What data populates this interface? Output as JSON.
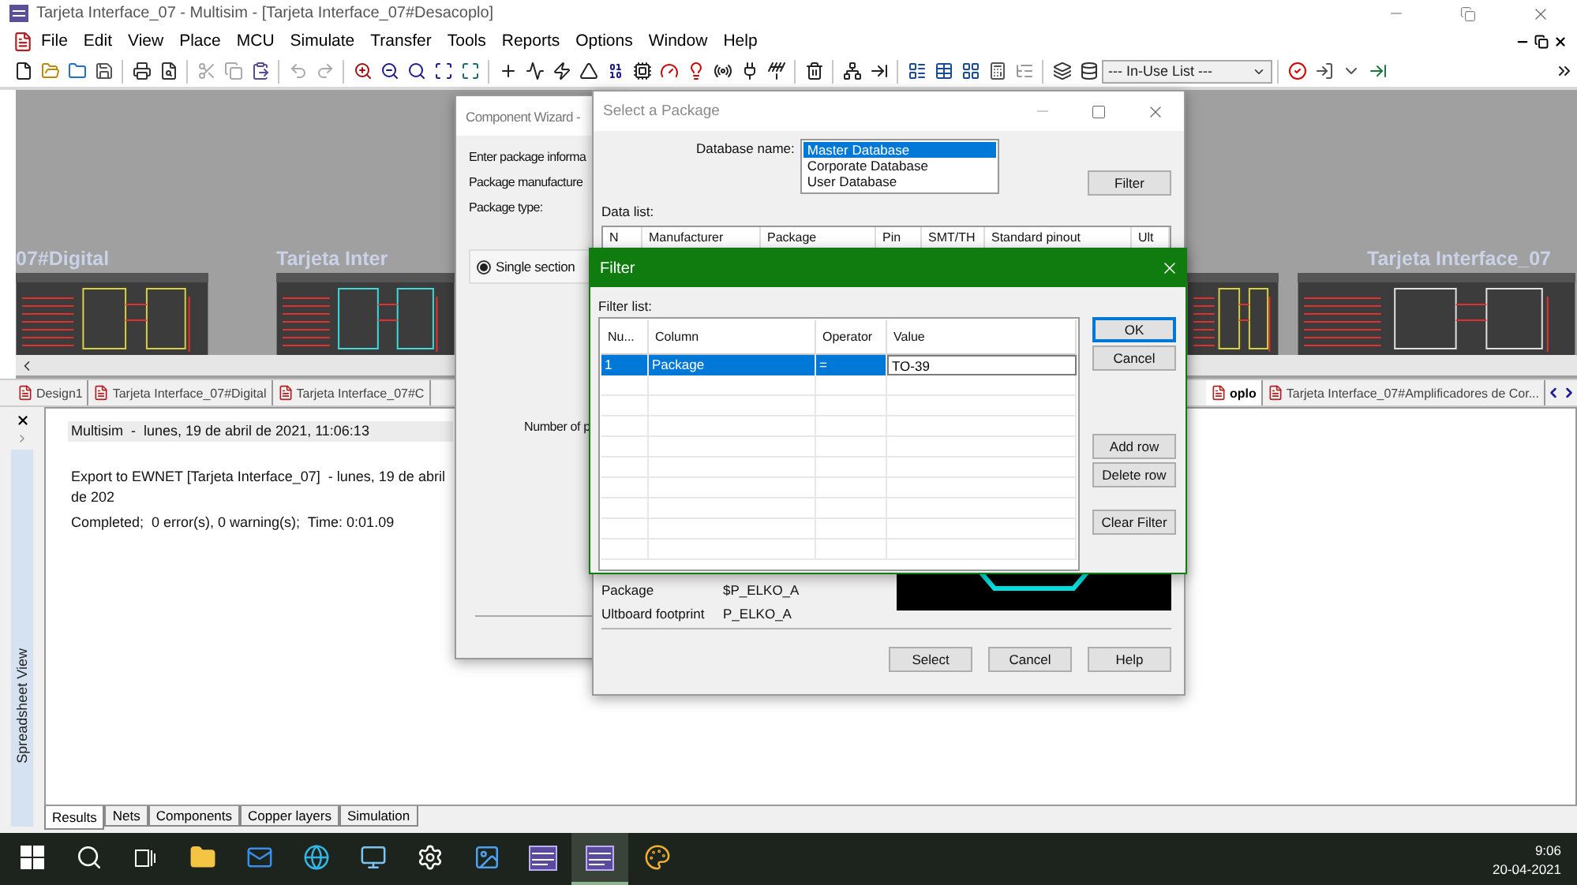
{
  "window": {
    "title": "Tarjeta Interface_07 - Multisim - [Tarjeta Interface_07#Desacoplo]"
  },
  "menu": [
    "File",
    "Edit",
    "View",
    "Place",
    "MCU",
    "Simulate",
    "Transfer",
    "Tools",
    "Reports",
    "Options",
    "Window",
    "Help"
  ],
  "toolbar": {
    "in_use_list": "--- In-Use List ---"
  },
  "canvases": [
    {
      "label": "07#Digital"
    },
    {
      "label": "Tarjeta Inter"
    },
    {
      "label": "Tarjeta Interface_07"
    }
  ],
  "design_tabs": [
    {
      "label": "Design1",
      "selected": false
    },
    {
      "label": "Tarjeta Interface_07#Digital",
      "selected": false
    },
    {
      "label": "Tarjeta Interface_07#C",
      "selected": false
    },
    {
      "label": "oplo",
      "selected": true
    },
    {
      "label": "Tarjeta Interface_07#Amplificadores de Cor...",
      "selected": false
    }
  ],
  "spreadsheet": {
    "title": "Spreadsheet View",
    "lines": [
      {
        "text": "Multisim  -  lunes, 19 de abril de 2021, 11:06:13",
        "kind": "header"
      },
      {
        "text": "Export to EWNET [Tarjeta Interface_07]  - lunes, 19 de abril de 202",
        "kind": "line"
      },
      {
        "text": "Completed;  0 error(s), 0 warning(s);  Time: 0:01.09",
        "kind": "line"
      }
    ],
    "tabs": [
      {
        "label": "Results",
        "selected": true
      },
      {
        "label": "Nets",
        "selected": false
      },
      {
        "label": "Components",
        "selected": false
      },
      {
        "label": "Copper layers",
        "selected": false
      },
      {
        "label": "Simulation",
        "selected": false
      }
    ]
  },
  "wizard": {
    "title": "Component Wizard -",
    "labels": [
      "Enter package informa",
      "Package manufacture",
      "Package type:"
    ],
    "radio": {
      "label": "Single section",
      "selected": true
    },
    "number_label": "Number of p"
  },
  "select_package": {
    "title": "Select a Package",
    "database_label": "Database name:",
    "databases": [
      {
        "label": "Master Database",
        "selected": true
      },
      {
        "label": "Corporate Database",
        "selected": false
      },
      {
        "label": "User Database",
        "selected": false
      }
    ],
    "filter_button": "Filter",
    "data_list_label": "Data list:",
    "columns": [
      "N",
      "Manufacturer",
      "Package",
      "Pin",
      "SMT/TH",
      "Standard pinout",
      "Ult"
    ],
    "fields": [
      {
        "label": "Package",
        "value": "$P_ELKO_A"
      },
      {
        "label": "Ultboard footprint",
        "value": "P_ELKO_A"
      }
    ],
    "buttons": [
      "Select",
      "Cancel",
      "Help"
    ]
  },
  "filter": {
    "title": "Filter",
    "list_label": "Filter list:",
    "columns": [
      "Nu...",
      "Column",
      "Operator",
      "Value"
    ],
    "rows": [
      {
        "cells": [
          "1",
          "Package",
          "=",
          "TO-39"
        ],
        "selected": true
      }
    ],
    "button_groups": [
      [
        {
          "label": "OK",
          "default": true
        },
        {
          "label": "Cancel",
          "default": false
        }
      ],
      [
        {
          "label": "Add row",
          "default": false
        },
        {
          "label": "Delete row",
          "default": false
        }
      ],
      [
        {
          "label": "Clear Filter",
          "default": false
        }
      ]
    ]
  },
  "taskbar": {
    "items": [
      {
        "kind": "start",
        "active": false
      },
      {
        "kind": "search",
        "active": false
      },
      {
        "kind": "taskview",
        "active": false
      },
      {
        "kind": "folder",
        "active": false
      },
      {
        "kind": "mail",
        "active": false
      },
      {
        "kind": "browser",
        "active": false
      },
      {
        "kind": "monitor",
        "active": false
      },
      {
        "kind": "settings",
        "active": false
      },
      {
        "kind": "photos",
        "active": false
      },
      {
        "kind": "circuit",
        "active": false
      },
      {
        "kind": "circuit",
        "active": true
      },
      {
        "kind": "paint",
        "active": false
      }
    ],
    "time": "9:06",
    "date": "20-04-2021"
  }
}
